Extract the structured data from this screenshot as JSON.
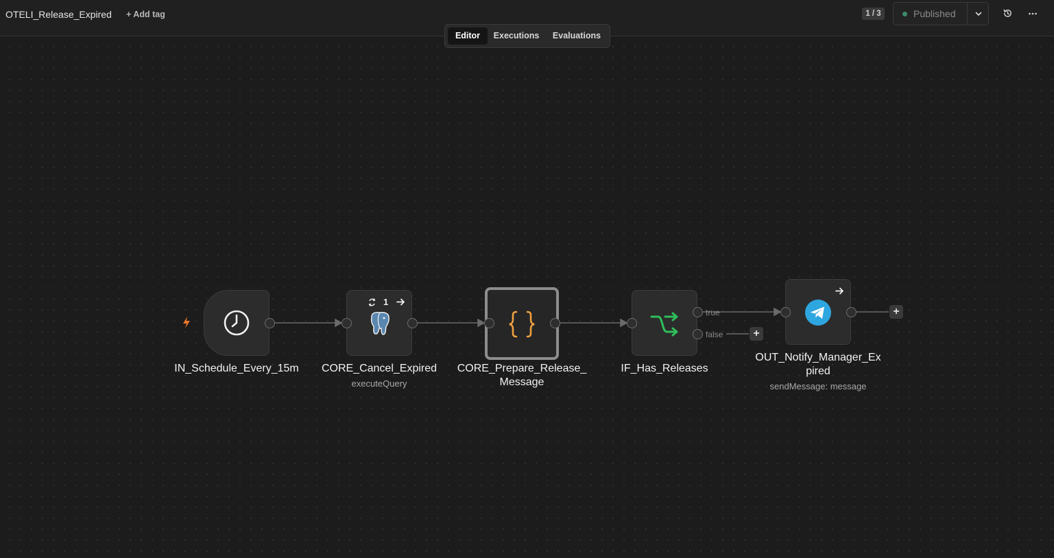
{
  "header": {
    "workflow_title": "OTELI_Release_Expired",
    "add_tag": "+ Add tag",
    "version_badge": "1 / 3",
    "publish_status": "Published"
  },
  "tabs": [
    {
      "label": "Editor",
      "active": true
    },
    {
      "label": "Executions",
      "active": false
    },
    {
      "label": "Evaluations",
      "active": false
    }
  ],
  "nodes": [
    {
      "name": "IN_Schedule_Every_15m",
      "subtitle": "",
      "icon": "clock-icon"
    },
    {
      "name": "CORE_Cancel_Expired",
      "subtitle": "executeQuery",
      "icon": "postgres-elephant-icon",
      "run_count": "1"
    },
    {
      "name": "CORE_Prepare_Release_\nMessage",
      "subtitle": "",
      "icon": "code-braces-icon"
    },
    {
      "name": "IF_Has_Releases",
      "subtitle": "",
      "icon": "branch-arrows-icon",
      "outputs": [
        "true",
        "false"
      ]
    },
    {
      "name": "OUT_Notify_Manager_Ex\npired",
      "subtitle": "sendMessage: message",
      "icon": "telegram-icon"
    }
  ],
  "colors": {
    "canvas_bg": "#1c1c1c",
    "trigger_bolt": "#e8742a",
    "code_braces": "#f0a040",
    "if_arrows": "#2fbf5a",
    "telegram": "#2ea6e0",
    "postgres": "#5a87b0",
    "published_dot": "#3b8a6a"
  }
}
